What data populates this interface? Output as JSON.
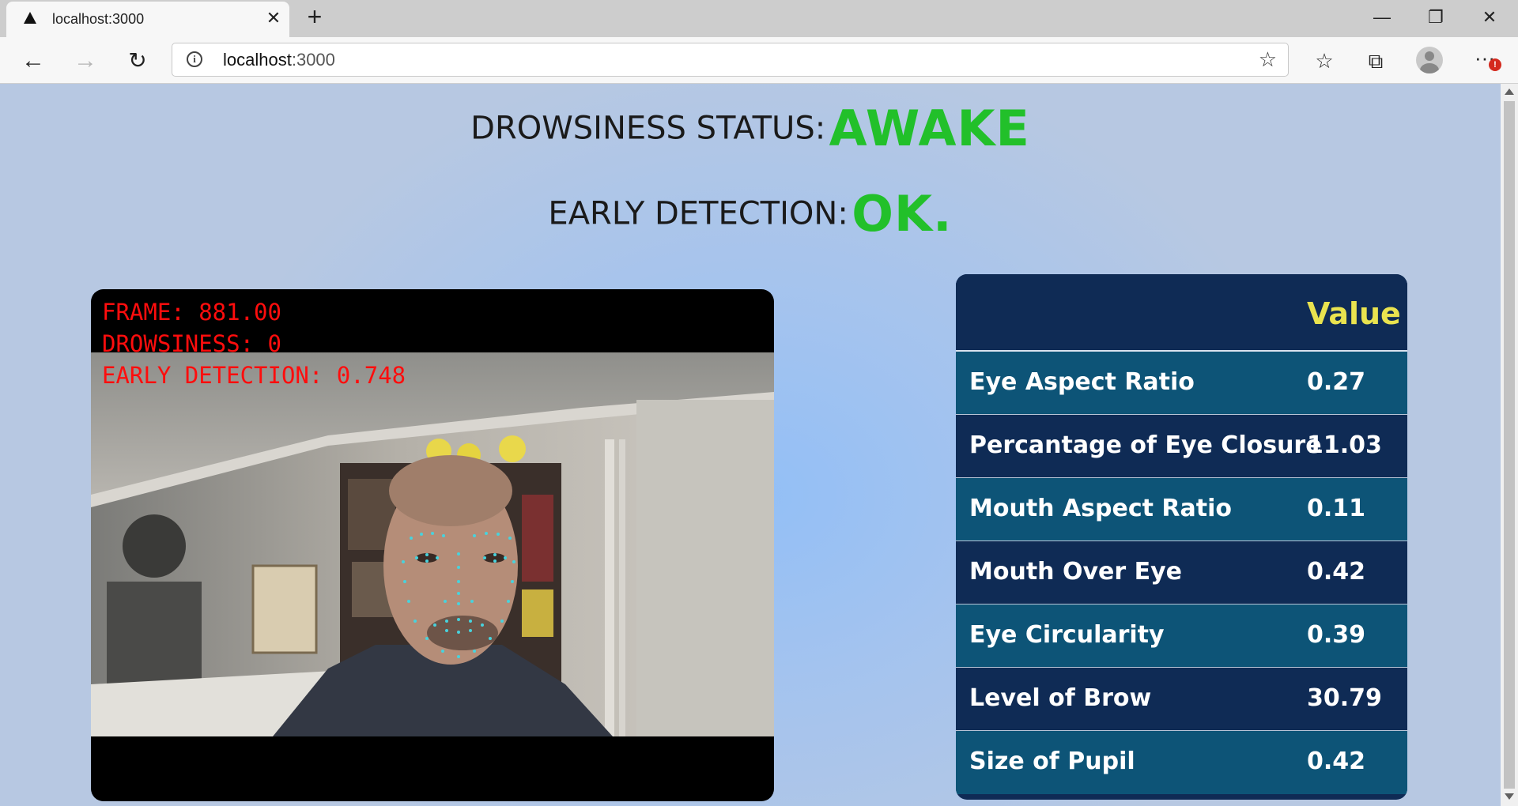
{
  "browser": {
    "tab_title": "localhost:3000",
    "url_host": "localhost",
    "url_port": ":3000",
    "icons": {
      "favicon": "triangle-favicon-icon",
      "tab_close": "close-icon",
      "new_tab": "plus-icon",
      "back": "arrow-left-icon",
      "forward": "arrow-right-icon",
      "reload": "reload-icon",
      "site_info": "info-icon",
      "add_favorite": "star-add-icon",
      "favorites": "favorites-icon",
      "collections": "collections-icon",
      "profile": "avatar",
      "menu": "ellipsis-icon"
    },
    "menu_badge": "!"
  },
  "page": {
    "drowsiness_label": "DROWSINESS STATUS:",
    "drowsiness_value": "AWAKE",
    "early_label": "EARLY DETECTION:",
    "early_value": "OK.",
    "status_color": "#22c02a",
    "video_overlay": {
      "frame": "FRAME: 881.00",
      "drowsiness": "DROWSINESS: 0",
      "early_detection": "EARLY DETECTION: 0.748",
      "overlay_color": "#ff0d0d"
    },
    "table": {
      "value_header": "Value",
      "header_color": "#e9e34f",
      "rows": [
        {
          "metric": "Eye Aspect Ratio",
          "value": "0.27"
        },
        {
          "metric": "Percantage of Eye Closure",
          "value": "11.03"
        },
        {
          "metric": "Mouth Aspect Ratio",
          "value": "0.11"
        },
        {
          "metric": "Mouth Over Eye",
          "value": "0.42"
        },
        {
          "metric": "Eye Circularity",
          "value": "0.39"
        },
        {
          "metric": "Level of Brow",
          "value": "30.79"
        },
        {
          "metric": "Size of Pupil",
          "value": "0.42"
        }
      ]
    }
  }
}
